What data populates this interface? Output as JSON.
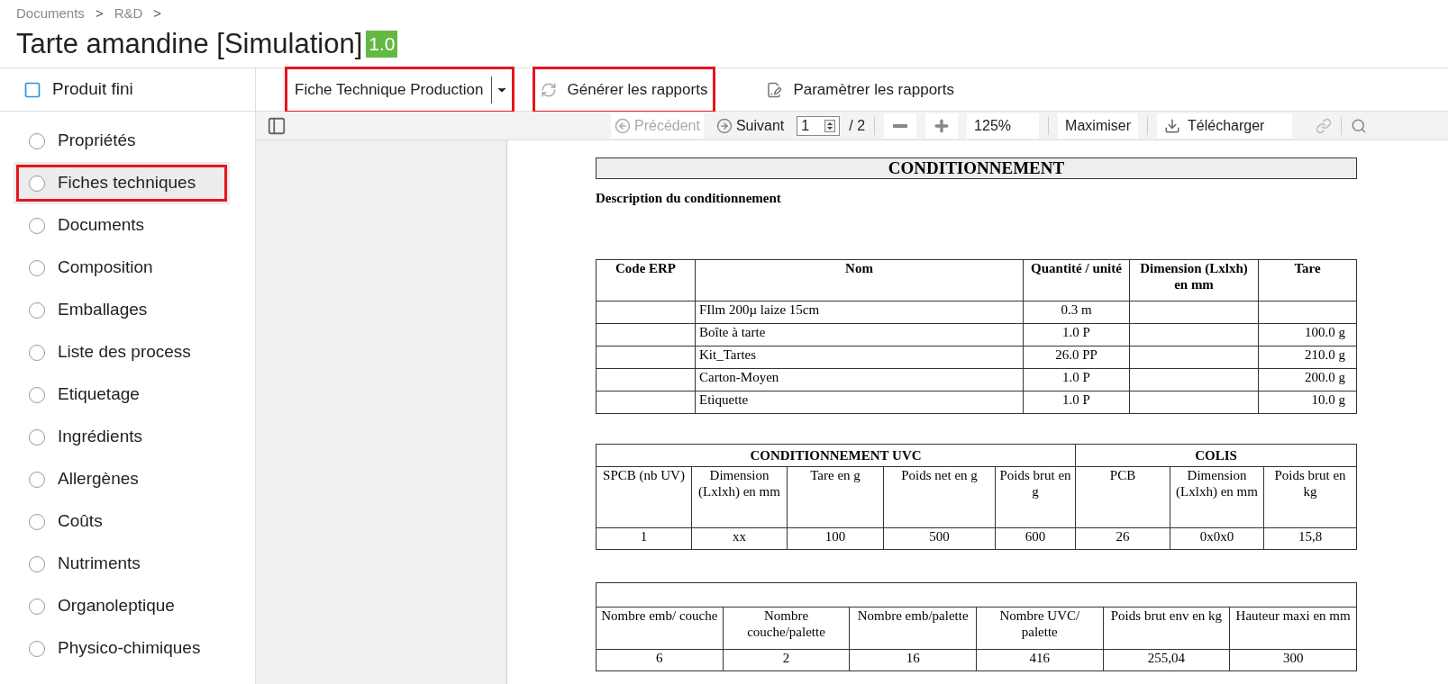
{
  "breadcrumb": [
    {
      "label": "Documents",
      "separator": ">"
    },
    {
      "label": "R&D",
      "separator": ">"
    }
  ],
  "title": "Tarte amandine [Simulation]",
  "version": "1.0",
  "sidebar": {
    "header": "Produit fini",
    "items": [
      {
        "label": "Propriétés",
        "selected": false,
        "highlighted": false
      },
      {
        "label": "Fiches techniques",
        "selected": true,
        "highlighted": true
      },
      {
        "label": "Documents",
        "selected": false,
        "highlighted": false
      },
      {
        "label": "Composition",
        "selected": false,
        "highlighted": false
      },
      {
        "label": "Emballages",
        "selected": false,
        "highlighted": false
      },
      {
        "label": "Liste des process",
        "selected": false,
        "highlighted": false
      },
      {
        "label": "Etiquetage",
        "selected": false,
        "highlighted": false
      },
      {
        "label": "Ingrédients",
        "selected": false,
        "highlighted": false
      },
      {
        "label": "Allergènes",
        "selected": false,
        "highlighted": false
      },
      {
        "label": "Coûts",
        "selected": false,
        "highlighted": false
      },
      {
        "label": "Nutriments",
        "selected": false,
        "highlighted": false
      },
      {
        "label": "Organoleptique",
        "selected": false,
        "highlighted": false
      },
      {
        "label": "Physico-chimiques",
        "selected": false,
        "highlighted": false
      }
    ]
  },
  "toolbar": {
    "report_select": {
      "value": "Fiche Technique Production",
      "highlighted": true
    },
    "actions": [
      {
        "label": "Générer les rapports",
        "kind": "generate",
        "highlighted": true
      },
      {
        "label": "Paramètrer les rapports",
        "kind": "settings",
        "highlighted": false
      }
    ]
  },
  "viewer": {
    "previous": {
      "label": "Précédent",
      "disabled": true
    },
    "next": {
      "label": "Suivant",
      "disabled": false
    },
    "page": "1",
    "page_count": "/ 2",
    "zoom": "125%",
    "maximize": "Maximiser",
    "download": "Télécharger"
  },
  "document": {
    "heading": "CONDITIONNEMENT",
    "subheading": "Description du conditionnement",
    "packaging_table": {
      "columns": [
        "Code ERP",
        "Nom",
        "Quantité / unité",
        "Dimension (Lxlxh) en mm",
        "Tare"
      ],
      "rows": [
        [
          "",
          "FIlm 200µ laize 15cm",
          "0.3 m",
          "",
          ""
        ],
        [
          "",
          "Boîte à tarte",
          "1.0 P",
          "",
          "100.0 g"
        ],
        [
          "",
          "Kit_Tartes",
          "26.0 PP",
          "",
          "210.0 g"
        ],
        [
          "",
          "Carton-Moyen",
          "1.0 P",
          "",
          "200.0 g"
        ],
        [
          "",
          "Etiquette",
          "1.0 P",
          "",
          "10.0 g"
        ]
      ]
    },
    "unit_table": {
      "groups": [
        {
          "label": "CONDITIONNEMENT UVC",
          "columns": [
            "SPCB (nb UV)",
            "Dimension (Lxlxh) en mm",
            "Tare en g",
            "Poids net en g",
            "Poids brut en g"
          ]
        },
        {
          "label": "COLIS",
          "columns": [
            "PCB",
            "Dimension (Lxlxh) en mm",
            "Poids brut en kg"
          ]
        }
      ],
      "row": [
        "1",
        "xx",
        "100",
        "500",
        "600",
        "26",
        "0x0x0",
        "15,8"
      ]
    },
    "pallet_table": {
      "columns": [
        "Nombre emb/ couche",
        "Nombre couche/palette",
        "Nombre emb/palette",
        "Nombre UVC/ palette",
        "Poids brut env en kg",
        "Hauteur maxi en mm"
      ],
      "row": [
        "6",
        "2",
        "16",
        "416",
        "255,04",
        "300"
      ]
    }
  }
}
